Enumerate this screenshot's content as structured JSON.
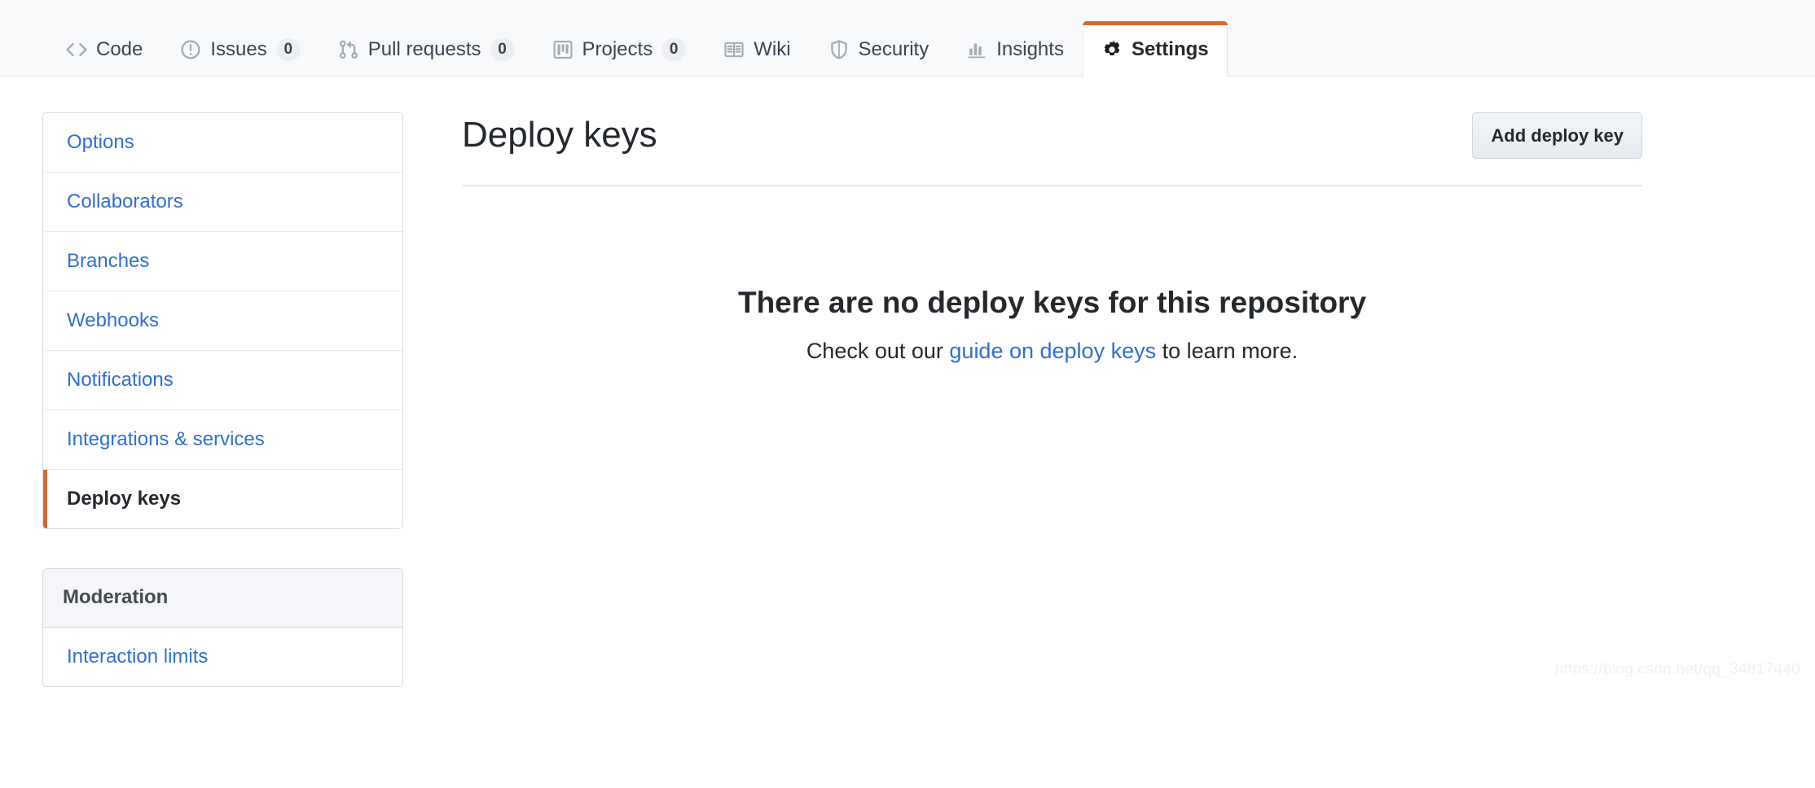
{
  "repo_nav": {
    "tabs": [
      {
        "label": "Code",
        "icon": "code-icon",
        "count": null,
        "active": false
      },
      {
        "label": "Issues",
        "icon": "issue-opened-icon",
        "count": "0",
        "active": false
      },
      {
        "label": "Pull requests",
        "icon": "git-pull-request-icon",
        "count": "0",
        "active": false
      },
      {
        "label": "Projects",
        "icon": "project-board-icon",
        "count": "0",
        "active": false
      },
      {
        "label": "Wiki",
        "icon": "book-icon",
        "count": null,
        "active": false
      },
      {
        "label": "Security",
        "icon": "shield-icon",
        "count": null,
        "active": false
      },
      {
        "label": "Insights",
        "icon": "graph-icon",
        "count": null,
        "active": false
      },
      {
        "label": "Settings",
        "icon": "gear-icon",
        "count": null,
        "active": true
      }
    ]
  },
  "sidebar": {
    "groups": [
      {
        "heading": null,
        "items": [
          {
            "label": "Options",
            "selected": false
          },
          {
            "label": "Collaborators",
            "selected": false
          },
          {
            "label": "Branches",
            "selected": false
          },
          {
            "label": "Webhooks",
            "selected": false
          },
          {
            "label": "Notifications",
            "selected": false
          },
          {
            "label": "Integrations & services",
            "selected": false
          },
          {
            "label": "Deploy keys",
            "selected": true
          }
        ]
      },
      {
        "heading": "Moderation",
        "items": [
          {
            "label": "Interaction limits",
            "selected": false
          }
        ]
      }
    ]
  },
  "main": {
    "page_title": "Deploy keys",
    "add_button_label": "Add deploy key",
    "blankslate": {
      "title": "There are no deploy keys for this repository",
      "desc_before": "Check out our ",
      "desc_link": "guide on deploy keys",
      "desc_after": " to learn more."
    }
  },
  "watermark": "https://blog.csdn.net/qq_34817440",
  "colors": {
    "link_blue": "#2f6fd4",
    "accent_orange": "#d9662a",
    "text_dark": "#24292e",
    "nav_bg": "#f8f9fb",
    "border": "#d5d9de",
    "heading_bg": "#f4f6f9"
  }
}
